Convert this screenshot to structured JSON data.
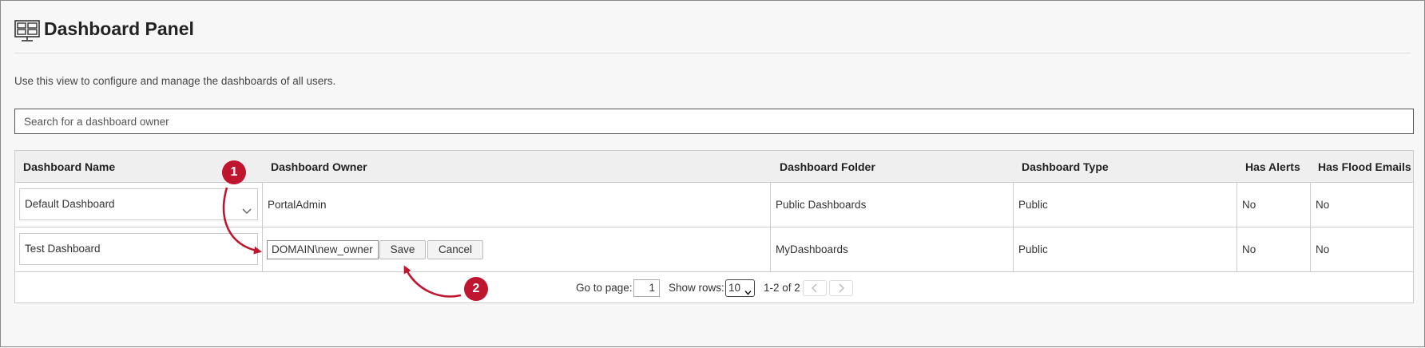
{
  "page": {
    "title": "Dashboard Panel",
    "description": "Use this view to configure and manage the dashboards of all users.",
    "icon": "dashboard-panel-icon"
  },
  "search": {
    "placeholder": "Search for a dashboard owner"
  },
  "table": {
    "columns": [
      "Dashboard Name",
      "Dashboard Owner",
      "Dashboard Folder",
      "Dashboard Type",
      "Has Alerts",
      "Has Flood Emails"
    ],
    "rows": [
      {
        "name": "Default Dashboard",
        "owner": "PortalAdmin",
        "folder": "Public Dashboards",
        "type": "Public",
        "has_alerts": "No",
        "has_flood_emails": "No"
      },
      {
        "name": "Test Dashboard",
        "owner_edit_value": "DOMAIN\\new_owner",
        "save_label": "Save",
        "cancel_label": "Cancel",
        "folder": "MyDashboards",
        "type": "Public",
        "has_alerts": "No",
        "has_flood_emails": "No"
      }
    ]
  },
  "pager": {
    "goto_label": "Go to page:",
    "page": "1",
    "rows_label": "Show rows:",
    "rows_value": "10",
    "range": "1-2 of 2"
  },
  "annotations": {
    "step1": "1",
    "step2": "2",
    "color": "#c0152f"
  }
}
